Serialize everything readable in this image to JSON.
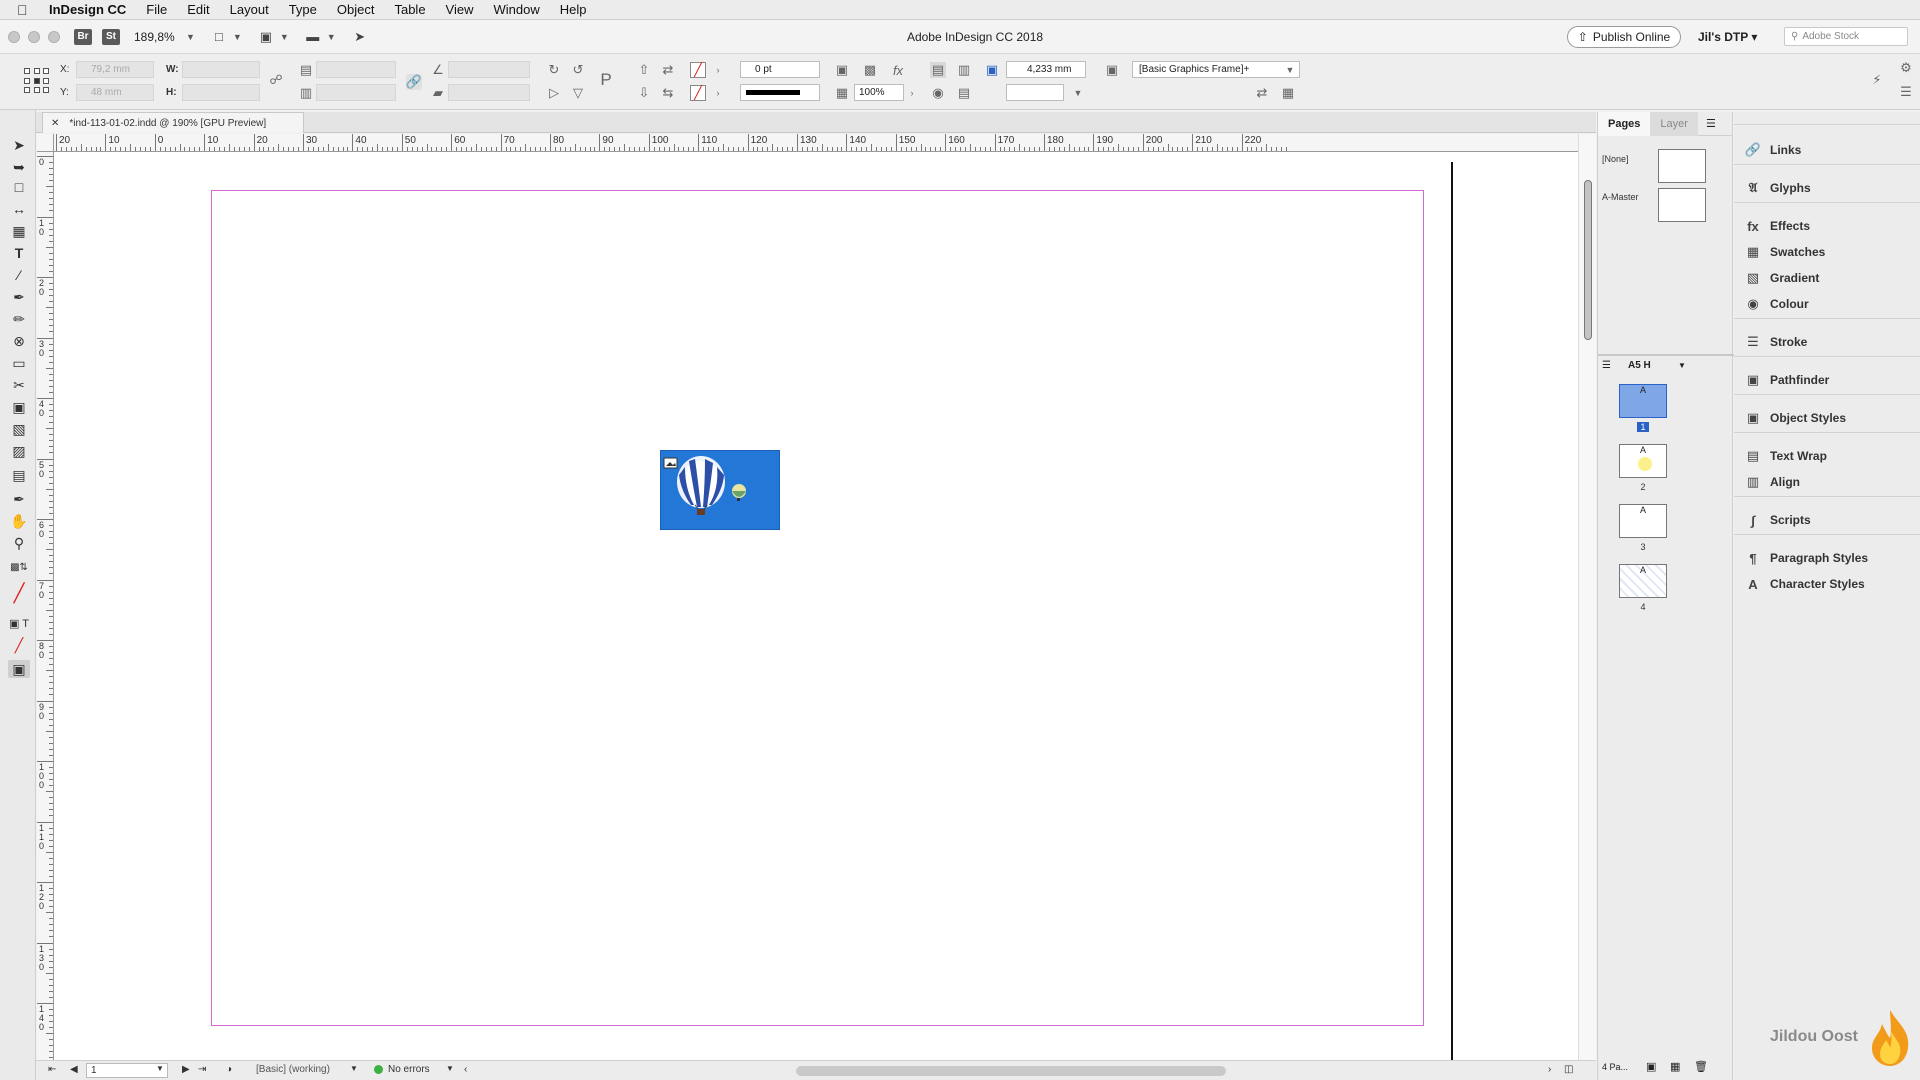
{
  "menubar": {
    "app_name": "InDesign CC",
    "items": [
      "File",
      "Edit",
      "Layout",
      "Type",
      "Object",
      "Table",
      "View",
      "Window",
      "Help"
    ]
  },
  "appbar": {
    "bridge_label": "Br",
    "stock_label": "St",
    "zoom": "189,8%",
    "title": "Adobe InDesign CC 2018",
    "publish_label": "Publish Online",
    "workspace": "Jil's DTP",
    "stock_search_placeholder": "Adobe Stock"
  },
  "control": {
    "x_label": "X:",
    "y_label": "Y:",
    "w_label": "W:",
    "h_label": "H:",
    "x_value": "79,2 mm",
    "y_value": "48 mm",
    "stroke_weight": "0 pt",
    "opacity": "100%",
    "offset_value": "4,233 mm",
    "object_style": "[Basic Graphics Frame]+"
  },
  "document_tab": {
    "label": "*ind-113-01-02.indd @ 190% [GPU Preview]"
  },
  "hruler_ticks": [
    "20",
    "10",
    "0",
    "10",
    "20",
    "30",
    "40",
    "50",
    "60",
    "70",
    "80",
    "90",
    "100",
    "110",
    "120",
    "130",
    "140",
    "150",
    "160",
    "170",
    "180",
    "190",
    "200",
    "210",
    "220"
  ],
  "vruler_ticks": [
    "0",
    "1 0",
    "2 0",
    "3 0",
    "4 0",
    "5 0",
    "6 0",
    "7 0",
    "8 0",
    "9 0",
    "1 0 0",
    "1 1 0",
    "1 2 0",
    "1 3 0",
    "1 4 0"
  ],
  "status": {
    "page_field": "1",
    "preflight_profile": "[Basic] (working)",
    "preflight_status": "No errors"
  },
  "pages_panel": {
    "tab_pages": "Pages",
    "tab_layers": "Layer",
    "master_none": "[None]",
    "master_a": "A-Master",
    "page_size": "A5 H",
    "pages": [
      {
        "label": "A",
        "number": "1"
      },
      {
        "label": "A",
        "number": "2"
      },
      {
        "label": "A",
        "number": "3"
      },
      {
        "label": "A",
        "number": "4"
      }
    ],
    "footer_count": "4 Pa..."
  },
  "dock": {
    "items": [
      "Links",
      "Glyphs",
      "Effects",
      "Swatches",
      "Gradient",
      "Colour",
      "Stroke",
      "Pathfinder",
      "Object Styles",
      "Text Wrap",
      "Align",
      "Scripts",
      "Paragraph Styles",
      "Character Styles"
    ],
    "icons": [
      "links-icon",
      "glyphs-icon",
      "effects-icon",
      "swatches-icon",
      "gradient-icon",
      "colour-icon",
      "stroke-icon",
      "pathfinder-icon",
      "object-styles-icon",
      "text-wrap-icon",
      "align-icon",
      "scripts-icon",
      "paragraph-styles-icon",
      "character-styles-icon"
    ]
  },
  "watermark": "Jildou Oost",
  "colors": {
    "margin_guide": "#d36ad3",
    "selected_page": "#2b62c7",
    "sky_blue": "#2377d6"
  }
}
